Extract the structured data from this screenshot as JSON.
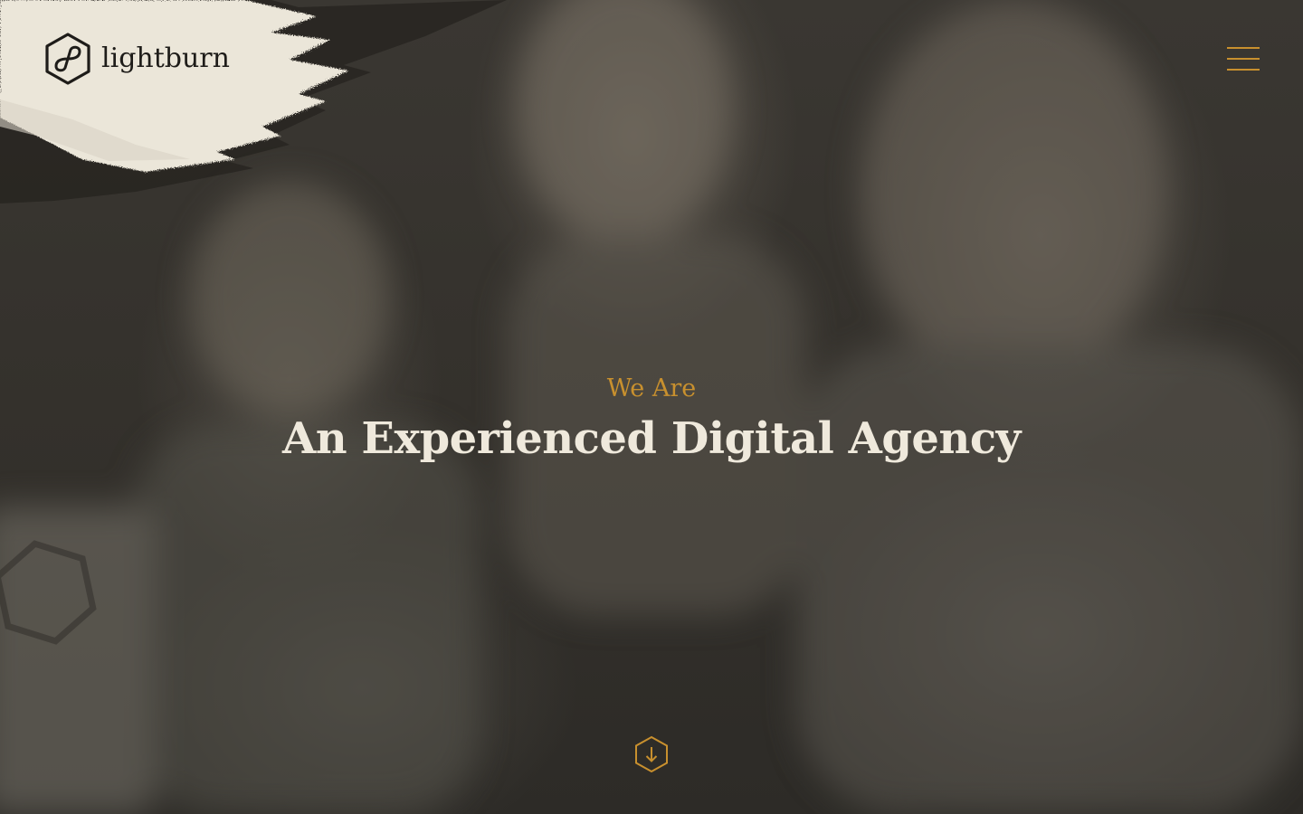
{
  "brand": {
    "name": "lightburn",
    "logo_icon": "hexagon-infinity-icon"
  },
  "header": {
    "menu_icon": "hamburger-menu-icon"
  },
  "hero": {
    "eyebrow": "We Are",
    "headline": "An Experienced Digital Agency",
    "scroll_icon": "arrow-down-hexagon-icon"
  },
  "colors": {
    "accent": "#c8902e",
    "headline_text": "#efe9dc",
    "brush_paint": "#ebe6d9",
    "logo_ink": "#1e1c19",
    "overlay": "#34312c"
  }
}
